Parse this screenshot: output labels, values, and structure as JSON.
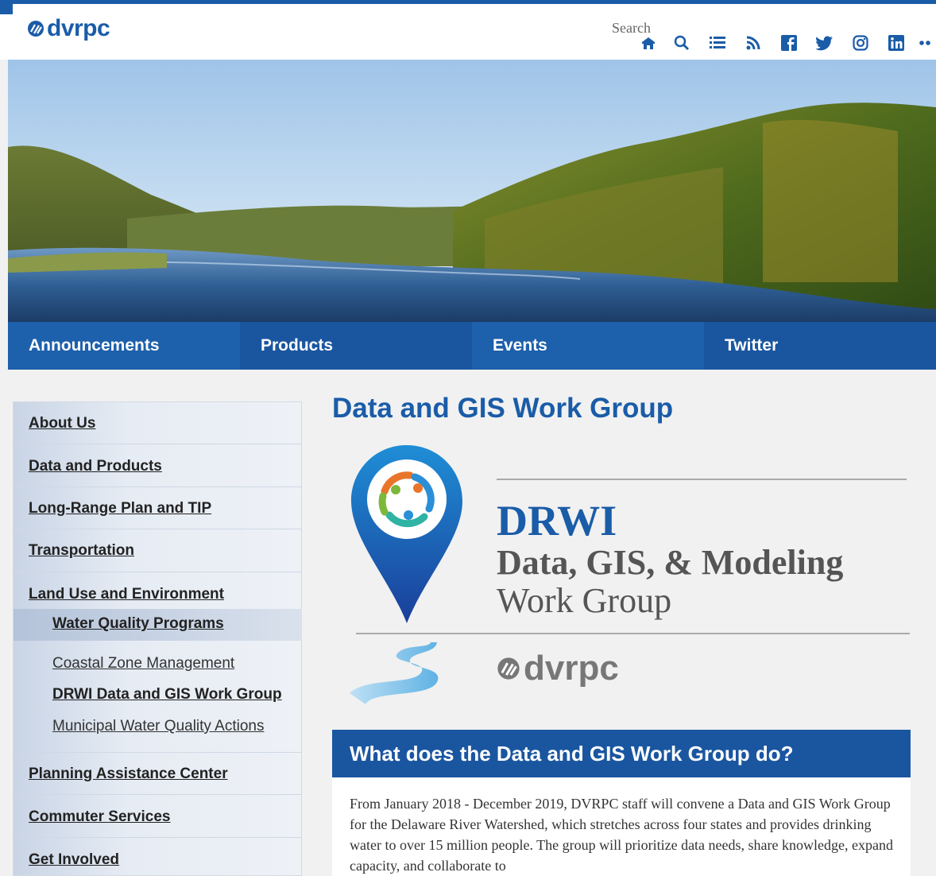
{
  "header": {
    "logo_text": "dvrpc",
    "search_label": "Search",
    "icons": [
      "home-icon",
      "search-icon",
      "list-icon",
      "rss-icon",
      "facebook-icon",
      "twitter-icon",
      "instagram-icon",
      "linkedin-icon",
      "more-icon"
    ]
  },
  "nav": {
    "tabs": [
      {
        "label": "Announcements"
      },
      {
        "label": "Products"
      },
      {
        "label": "Events"
      },
      {
        "label": "Twitter"
      }
    ]
  },
  "sidebar": {
    "items": [
      {
        "label": "About Us"
      },
      {
        "label": "Data and Products"
      },
      {
        "label": "Long-Range Plan and TIP"
      },
      {
        "label": "Transportation"
      },
      {
        "label": "Land Use and Environment"
      },
      {
        "label": "Planning Assistance Center"
      },
      {
        "label": "Commuter Services"
      },
      {
        "label": "Get Involved"
      }
    ],
    "sub_item": "Water Quality Programs",
    "sub_sub_items": [
      {
        "label": "Coastal Zone Management"
      },
      {
        "label": "DRWI Data and GIS Work Group"
      },
      {
        "label": "Municipal Water Quality Actions"
      }
    ]
  },
  "main": {
    "title": "Data and GIS Work Group",
    "logo_graphic": {
      "line1": "DRWI",
      "line2": "Data, GIS, & Modeling",
      "line3": "Work Group",
      "org": "dvrpc"
    },
    "section_heading": "What does the Data and GIS Work Group do?",
    "body": "From January 2018 - December 2019, DVRPC staff will convene a Data and GIS Work Group for the Delaware River Watershed, which stretches across four states and provides drinking water to over 15 million people. The group will prioritize data needs, share knowledge, expand capacity, and collaborate to"
  },
  "colors": {
    "brand": "#1a5ca8",
    "nav_bg": "#1a56a0"
  }
}
